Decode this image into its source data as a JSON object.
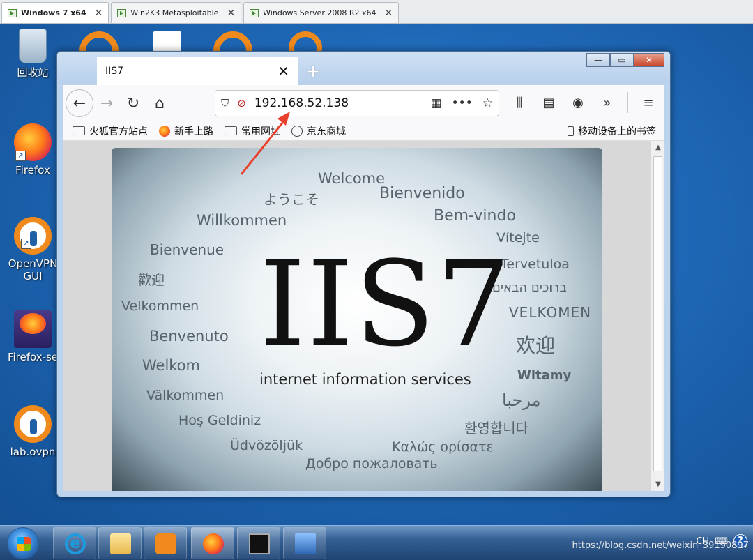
{
  "vm_tabs": [
    {
      "label": "Windows 7 x64",
      "active": true
    },
    {
      "label": "Win2K3 Metasploitable",
      "active": false
    },
    {
      "label": "Windows Server 2008 R2 x64",
      "active": false
    }
  ],
  "desktop_icons": [
    {
      "label": "回收站",
      "icon": "recycle-bin-icon"
    },
    {
      "label": "Firefox",
      "icon": "firefox-icon"
    },
    {
      "label": "OpenVPN GUI",
      "icon": "openvpn-icon"
    },
    {
      "label": "Firefox-se",
      "icon": "firefox-se-icon"
    },
    {
      "label": "lab.ovpn",
      "icon": "ovpn-file-icon"
    }
  ],
  "browser": {
    "tab_title": "IIS7",
    "tab_close": "✕",
    "new_tab": "+",
    "url": "192.168.52.138",
    "bookmarks": [
      "火狐官方站点",
      "新手上路",
      "常用网址",
      "京东商城"
    ],
    "mobile_bookmarks": "移动设备上的书签",
    "window_controls": {
      "minimize": "—",
      "maximize": "▭",
      "close": "✕"
    }
  },
  "iis_page": {
    "logo": "IIS7",
    "subtitle": "internet information services",
    "greetings": [
      "Welcome",
      "ようこそ",
      "Bienvenido",
      "Bem-vindo",
      "Willkommen",
      "Vítejte",
      "Bienvenue",
      "Tervetuloa",
      "歡迎",
      "ברוכים הבאים",
      "Velkommen",
      "VELKOMEN",
      "Benvenuto",
      "欢迎",
      "Welkom",
      "Witamy",
      "Välkommen",
      "مرحبا",
      "Hoş Geldiniz",
      "환영합니다",
      "Üdvözöljük",
      "Καλώς ορίσατε",
      "Добро пожаловать"
    ]
  },
  "taskbar": {
    "apps": [
      "internet-explorer-icon",
      "file-explorer-icon",
      "media-player-icon",
      "firefox-icon",
      "command-prompt-icon",
      "network-icon"
    ],
    "tray_lang": "CH",
    "help": "?"
  },
  "watermark": "https://blog.csdn.net/weixin_39190897",
  "colors": {
    "desktop": "#1f68b7",
    "annotation_arrow": "#e8402a",
    "urlbar_insecure": "#c81e1e"
  }
}
